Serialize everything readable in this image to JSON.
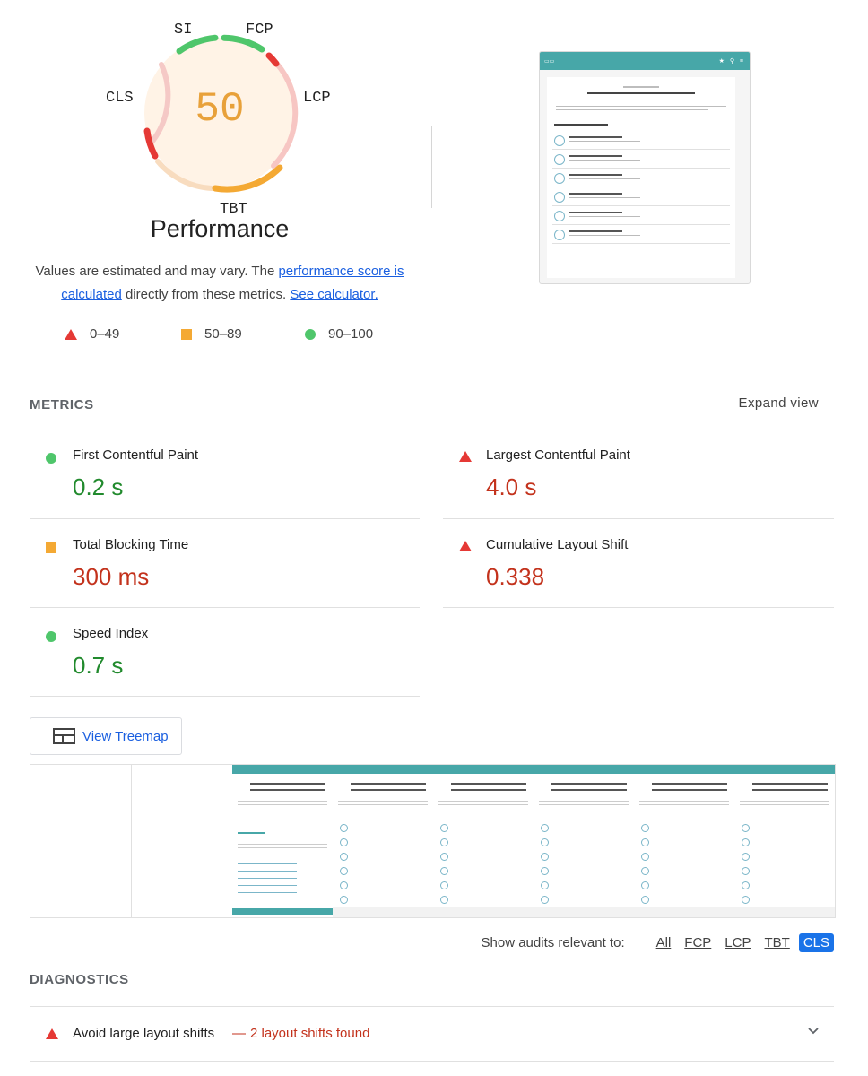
{
  "gauge": {
    "score": "50",
    "title": "Performance",
    "labels": {
      "si": "SI",
      "fcp": "FCP",
      "lcp": "LCP",
      "tbt": "TBT",
      "cls": "CLS"
    },
    "score_color": "#e8a13a"
  },
  "description": {
    "part1": "Values are estimated and may vary. The ",
    "link1": "performance score is calculated",
    "part2": " directly from these metrics. ",
    "link2": "See calculator."
  },
  "legend": [
    {
      "icon": "red-triangle-icon",
      "label": "0–49"
    },
    {
      "icon": "orange-square-icon",
      "label": "50–89"
    },
    {
      "icon": "green-circle-icon",
      "label": "90–100"
    }
  ],
  "metrics_section": {
    "title": "METRICS",
    "expand_label": "Expand view",
    "items": [
      {
        "name": "First Contentful Paint",
        "value": "0.2 s",
        "status": "pass"
      },
      {
        "name": "Largest Contentful Paint",
        "value": "4.0 s",
        "status": "fail"
      },
      {
        "name": "Total Blocking Time",
        "value": "300 ms",
        "status": "average"
      },
      {
        "name": "Cumulative Layout Shift",
        "value": "0.338",
        "status": "fail"
      },
      {
        "name": "Speed Index",
        "value": "0.7 s",
        "status": "pass"
      }
    ]
  },
  "treemap": {
    "label": "View Treemap"
  },
  "filter": {
    "label": "Show audits relevant to:",
    "options": [
      "All",
      "FCP",
      "LCP",
      "TBT",
      "CLS"
    ],
    "active": "CLS"
  },
  "diagnostics": {
    "title": "DIAGNOSTICS",
    "items": [
      {
        "title": "Avoid large layout shifts",
        "separator": "—",
        "detail": "2 layout shifts found",
        "status": "fail"
      }
    ]
  },
  "colors": {
    "fail": "#e53935",
    "average": "#f4a934",
    "pass": "#4fc66b",
    "link": "#1a5fe0",
    "accent_teal": "#47a7a8"
  }
}
